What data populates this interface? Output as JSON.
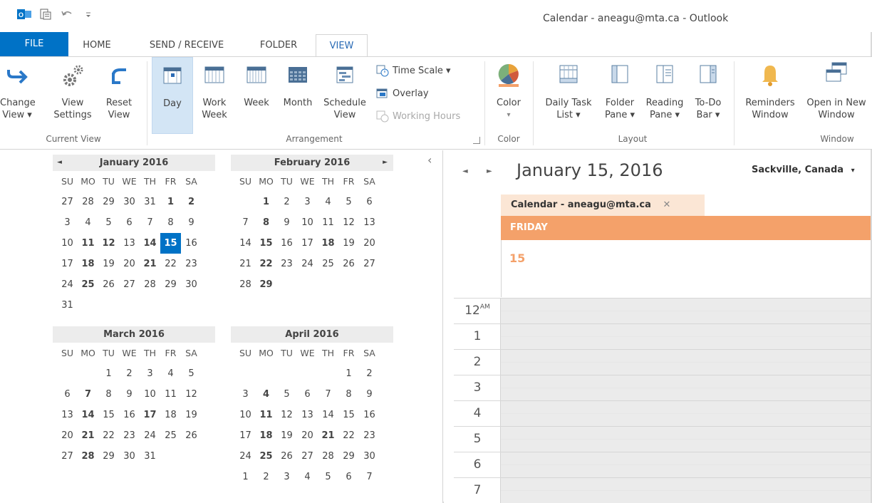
{
  "window": {
    "title": "Calendar - aneagu@mta.ca - Outlook"
  },
  "tabs": [
    {
      "label": "FILE"
    },
    {
      "label": "HOME"
    },
    {
      "label": "SEND / RECEIVE"
    },
    {
      "label": "FOLDER"
    },
    {
      "label": "VIEW"
    }
  ],
  "ribbon": {
    "current_view": {
      "change_view": {
        "l1": "Change",
        "l2": "View ▾"
      },
      "view_settings": {
        "l1": "View",
        "l2": "Settings"
      },
      "reset_view": {
        "l1": "Reset",
        "l2": "View"
      },
      "group": "Current View"
    },
    "arrangement": {
      "day": {
        "l1": "Day"
      },
      "work_week": {
        "l1": "Work",
        "l2": "Week"
      },
      "week": {
        "l1": "Week"
      },
      "month": {
        "l1": "Month"
      },
      "schedule_view": {
        "l1": "Schedule",
        "l2": "View"
      },
      "time_scale": "Time Scale ▾",
      "overlay": "Overlay",
      "working_hours": "Working Hours",
      "group": "Arrangement"
    },
    "color": {
      "label": "Color",
      "arrow": "▾",
      "group": "Color"
    },
    "layout": {
      "daily_task_list": {
        "l1": "Daily Task",
        "l2": "List ▾"
      },
      "folder_pane": {
        "l1": "Folder",
        "l2": "Pane ▾"
      },
      "reading_pane": {
        "l1": "Reading",
        "l2": "Pane ▾"
      },
      "todo_bar": {
        "l1": "To-Do",
        "l2": "Bar ▾"
      },
      "group": "Layout"
    },
    "window": {
      "reminders": {
        "l1": "Reminders",
        "l2": "Window"
      },
      "open_new": {
        "l1": "Open in New",
        "l2": "Window"
      },
      "group": "Window"
    }
  },
  "weekdays": [
    "SU",
    "MO",
    "TU",
    "WE",
    "TH",
    "FR",
    "SA"
  ],
  "months": [
    {
      "name": "January 2016",
      "days": [
        {
          "t": "27"
        },
        {
          "t": "28"
        },
        {
          "t": "29"
        },
        {
          "t": "30"
        },
        {
          "t": "31"
        },
        {
          "t": "1",
          "b": true
        },
        {
          "t": "2",
          "b": true
        },
        {
          "t": "3"
        },
        {
          "t": "4"
        },
        {
          "t": "5"
        },
        {
          "t": "6"
        },
        {
          "t": "7"
        },
        {
          "t": "8"
        },
        {
          "t": "9"
        },
        {
          "t": "10"
        },
        {
          "t": "11",
          "b": true
        },
        {
          "t": "12",
          "b": true
        },
        {
          "t": "13"
        },
        {
          "t": "14",
          "b": true
        },
        {
          "t": "15",
          "today": true
        },
        {
          "t": "16"
        },
        {
          "t": "17"
        },
        {
          "t": "18",
          "b": true
        },
        {
          "t": "19"
        },
        {
          "t": "20"
        },
        {
          "t": "21",
          "b": true
        },
        {
          "t": "22"
        },
        {
          "t": "23"
        },
        {
          "t": "24"
        },
        {
          "t": "25",
          "b": true
        },
        {
          "t": "26"
        },
        {
          "t": "27"
        },
        {
          "t": "28"
        },
        {
          "t": "29"
        },
        {
          "t": "30"
        },
        {
          "t": "31"
        }
      ]
    },
    {
      "name": "February 2016",
      "days": [
        {
          "t": ""
        },
        {
          "t": "1",
          "b": true
        },
        {
          "t": "2"
        },
        {
          "t": "3"
        },
        {
          "t": "4"
        },
        {
          "t": "5"
        },
        {
          "t": "6"
        },
        {
          "t": "7"
        },
        {
          "t": "8",
          "b": true
        },
        {
          "t": "9"
        },
        {
          "t": "10"
        },
        {
          "t": "11"
        },
        {
          "t": "12"
        },
        {
          "t": "13"
        },
        {
          "t": "14"
        },
        {
          "t": "15",
          "b": true
        },
        {
          "t": "16"
        },
        {
          "t": "17"
        },
        {
          "t": "18",
          "b": true
        },
        {
          "t": "19"
        },
        {
          "t": "20"
        },
        {
          "t": "21"
        },
        {
          "t": "22",
          "b": true
        },
        {
          "t": "23"
        },
        {
          "t": "24"
        },
        {
          "t": "25"
        },
        {
          "t": "26"
        },
        {
          "t": "27"
        },
        {
          "t": "28"
        },
        {
          "t": "29",
          "b": true
        }
      ]
    },
    {
      "name": "March 2016",
      "days": [
        {
          "t": ""
        },
        {
          "t": ""
        },
        {
          "t": "1"
        },
        {
          "t": "2"
        },
        {
          "t": "3"
        },
        {
          "t": "4"
        },
        {
          "t": "5"
        },
        {
          "t": "6"
        },
        {
          "t": "7",
          "b": true
        },
        {
          "t": "8"
        },
        {
          "t": "9"
        },
        {
          "t": "10"
        },
        {
          "t": "11"
        },
        {
          "t": "12"
        },
        {
          "t": "13"
        },
        {
          "t": "14",
          "b": true
        },
        {
          "t": "15"
        },
        {
          "t": "16"
        },
        {
          "t": "17",
          "b": true
        },
        {
          "t": "18"
        },
        {
          "t": "19"
        },
        {
          "t": "20"
        },
        {
          "t": "21",
          "b": true
        },
        {
          "t": "22"
        },
        {
          "t": "23"
        },
        {
          "t": "24"
        },
        {
          "t": "25"
        },
        {
          "t": "26"
        },
        {
          "t": "27"
        },
        {
          "t": "28",
          "b": true
        },
        {
          "t": "29"
        },
        {
          "t": "30"
        },
        {
          "t": "31"
        }
      ]
    },
    {
      "name": "April 2016",
      "days": [
        {
          "t": ""
        },
        {
          "t": ""
        },
        {
          "t": ""
        },
        {
          "t": ""
        },
        {
          "t": ""
        },
        {
          "t": "1"
        },
        {
          "t": "2"
        },
        {
          "t": "3"
        },
        {
          "t": "4",
          "b": true
        },
        {
          "t": "5"
        },
        {
          "t": "6"
        },
        {
          "t": "7"
        },
        {
          "t": "8"
        },
        {
          "t": "9"
        },
        {
          "t": "10"
        },
        {
          "t": "11",
          "b": true
        },
        {
          "t": "12"
        },
        {
          "t": "13"
        },
        {
          "t": "14"
        },
        {
          "t": "15"
        },
        {
          "t": "16"
        },
        {
          "t": "17"
        },
        {
          "t": "18",
          "b": true
        },
        {
          "t": "19"
        },
        {
          "t": "20"
        },
        {
          "t": "21",
          "b": true
        },
        {
          "t": "22"
        },
        {
          "t": "23"
        },
        {
          "t": "24"
        },
        {
          "t": "25",
          "b": true
        },
        {
          "t": "26"
        },
        {
          "t": "27"
        },
        {
          "t": "28"
        },
        {
          "t": "29"
        },
        {
          "t": "30"
        },
        {
          "t": "1"
        },
        {
          "t": "2"
        },
        {
          "t": "3"
        },
        {
          "t": "4"
        },
        {
          "t": "5"
        },
        {
          "t": "6"
        },
        {
          "t": "7"
        }
      ]
    }
  ],
  "day_view": {
    "date": "January 15, 2016",
    "location": "Sackville, Canada",
    "location_arrow": "▾",
    "calendar_tab": "Calendar - aneagu@mta.ca",
    "close": "✕",
    "day_name": "FRIDAY",
    "day_number": "15",
    "hours": [
      "12",
      "1",
      "2",
      "3",
      "4",
      "5",
      "6",
      "7"
    ],
    "am_label": "AM"
  },
  "icons": {
    "collapse": "‹",
    "prev": "◄",
    "next": "►"
  },
  "colors": {
    "accent": "#0072c6",
    "today": "#0072c6",
    "day_header": "#f4a16a"
  }
}
